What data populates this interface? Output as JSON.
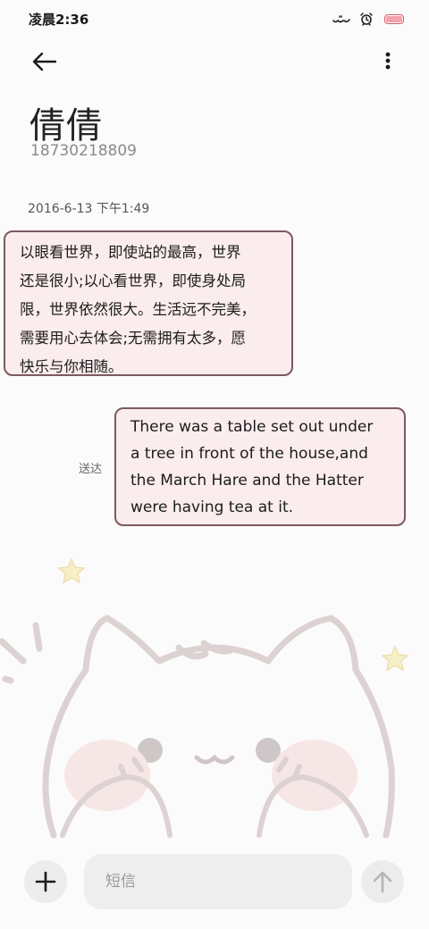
{
  "status_bar": {
    "time": "凌晨2:36",
    "icons": [
      "signal-icon",
      "alarm-icon",
      "battery-icon"
    ],
    "battery_color": "#d85a6a"
  },
  "header": {
    "back_icon": "arrow-left-icon",
    "more_icon": "more-vertical-icon"
  },
  "contact": {
    "name": "倩倩",
    "number": "18730218809"
  },
  "messages": [
    {
      "direction": "incoming",
      "date": "2016-6-13 下午1:49",
      "text": "以眼看世界，即使站的最高，世界\n还是很小;以心看世界，即使身处局\n限，世界依然很大。生活远不完美，\n需要用心去体会;无需拥有太多，愿\n快乐与你相随。"
    },
    {
      "direction": "outgoing",
      "status": "送达",
      "text": "There was a table set out under\na tree in front of the house,and\nthe March Hare and the Hatter\nwere having tea at it."
    }
  ],
  "input": {
    "placeholder": "短信",
    "value": ""
  },
  "colors": {
    "bubble_fill": "#fbeced",
    "bubble_border": "#7a5a60",
    "background": "#fcfbfb"
  }
}
